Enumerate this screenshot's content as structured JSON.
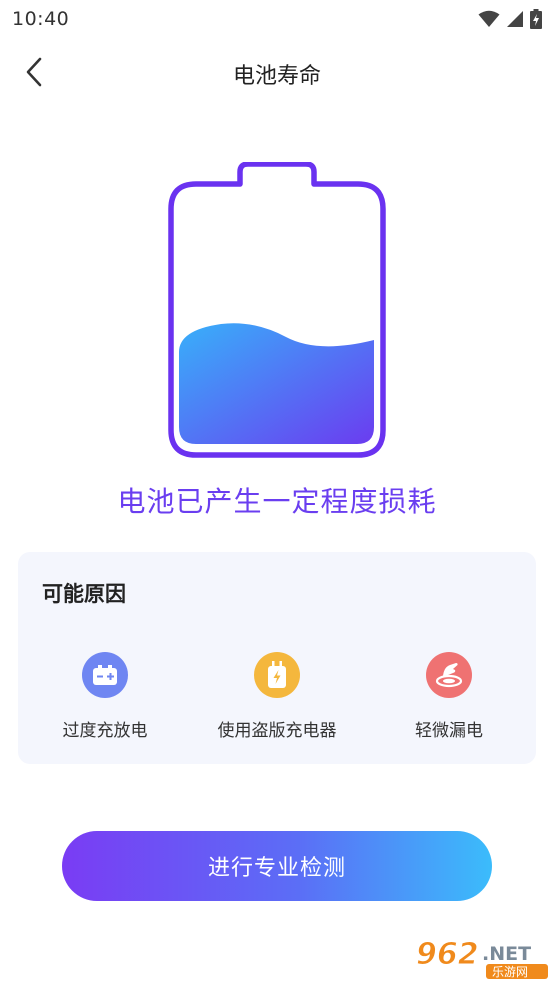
{
  "status_bar": {
    "time": "10:40",
    "icons": [
      "wifi-icon",
      "signal-icon",
      "battery-charging-icon"
    ]
  },
  "nav": {
    "back_icon": "chevron-left-icon",
    "title": "电池寿命"
  },
  "battery": {
    "icon": "battery-level-illustration",
    "outline_color": "#6a32f0",
    "fill_colors": [
      "#3aa6f8",
      "#6a3ef0"
    ]
  },
  "headline": "电池已产生一定程度损耗",
  "reasons": {
    "title": "可能原因",
    "items": [
      {
        "label": "过度充放电",
        "icon": "battery-plus-minus-icon",
        "color": "#6f86f2"
      },
      {
        "label": "使用盗版充电器",
        "icon": "charger-bolt-icon",
        "color": "#f4b73d"
      },
      {
        "label": "轻微漏电",
        "icon": "leak-hand-icon",
        "color": "#ef7272"
      }
    ]
  },
  "primary_button": {
    "label": "进行专业检测"
  },
  "watermark": {
    "text": "962.NET",
    "subtext": "乐游网"
  },
  "colors": {
    "accent": "#6a3ef0",
    "button_gradient_start": "#7a3cf4",
    "button_gradient_end": "#3bbcfb",
    "card_bg": "#f4f6fd"
  }
}
